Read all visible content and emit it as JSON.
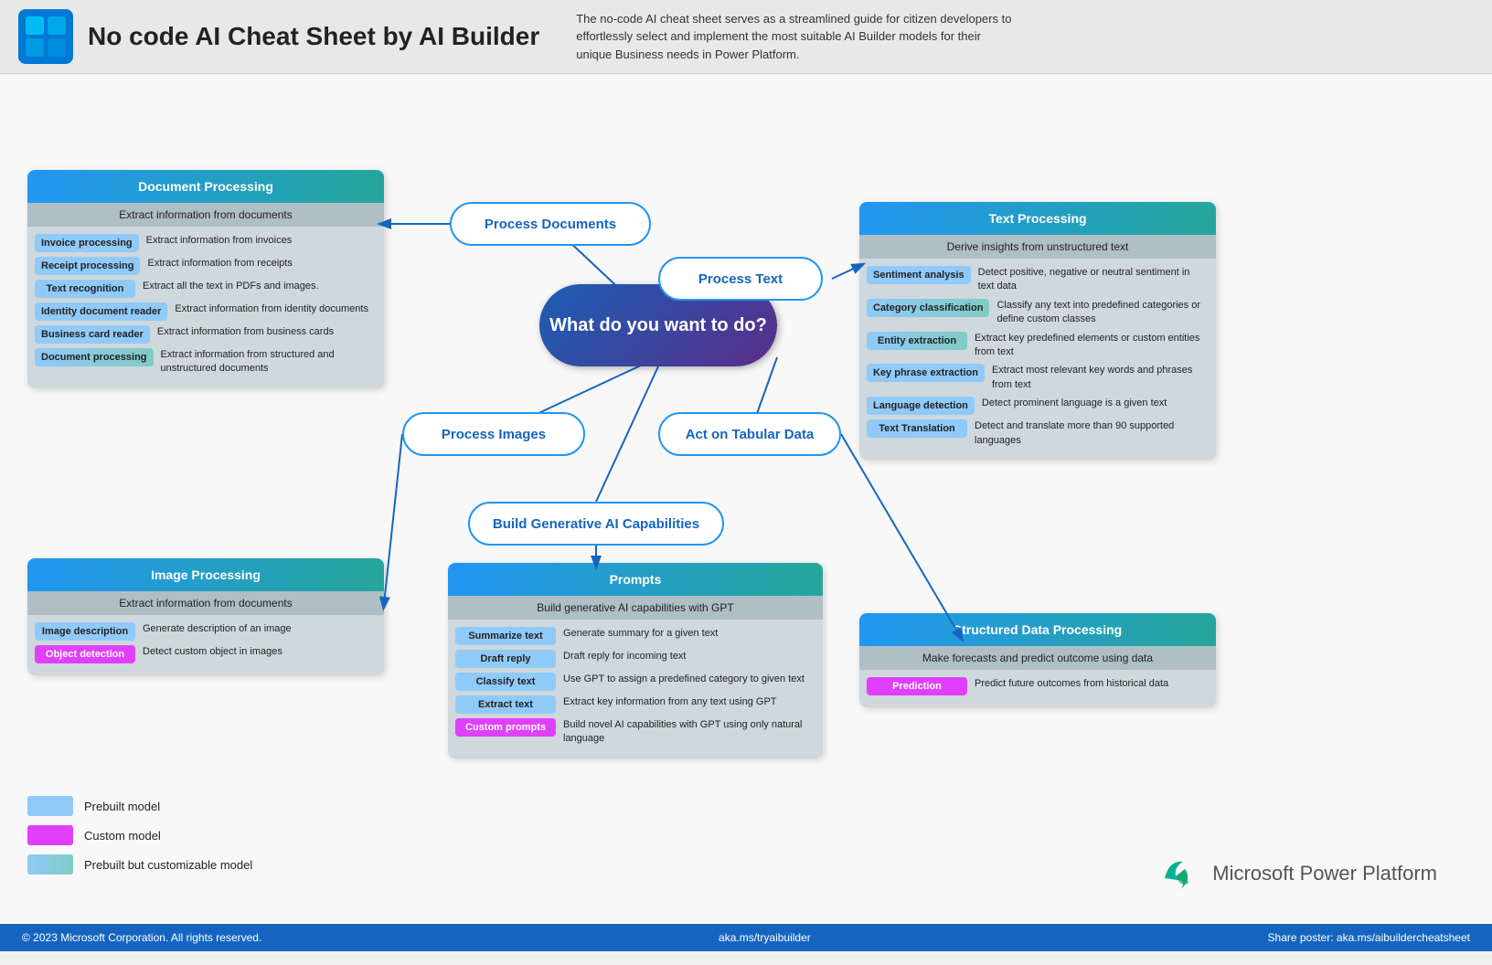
{
  "header": {
    "title": "No code AI Cheat Sheet by AI Builder",
    "description": "The no-code AI cheat sheet serves as a streamlined guide for citizen developers to effortlessly select and implement the most suitable AI Builder models for their unique Business needs in Power Platform."
  },
  "center_bubble": {
    "text": "What do you want to do?"
  },
  "flow_buttons": {
    "process_docs": "Process Documents",
    "process_text": "Process Text",
    "process_images": "Process Images",
    "tabular_data": "Act on Tabular Data",
    "gen_ai": "Build Generative AI Capabilities"
  },
  "document_processing": {
    "header": "Document Processing",
    "subheader": "Extract information from documents",
    "items": [
      {
        "badge": "Invoice processing",
        "badge_type": "blue",
        "desc": "Extract information from invoices"
      },
      {
        "badge": "Receipt processing",
        "badge_type": "blue",
        "desc": "Extract information from receipts"
      },
      {
        "badge": "Text  recognition",
        "badge_type": "blue",
        "desc": "Extract all the text in PDFs and images."
      },
      {
        "badge": "Identity document reader",
        "badge_type": "blue",
        "desc": "Extract information from identity documents"
      },
      {
        "badge": "Business card reader",
        "badge_type": "blue",
        "desc": "Extract information from business cards"
      },
      {
        "badge": "Document processing",
        "badge_type": "cyan",
        "desc": "Extract information from structured and unstructured documents"
      }
    ]
  },
  "text_processing": {
    "header": "Text Processing",
    "subheader": "Derive insights from unstructured text",
    "items": [
      {
        "badge": "Sentiment analysis",
        "badge_type": "blue",
        "desc": "Detect positive, negative or neutral sentiment in text data"
      },
      {
        "badge": "Category classification",
        "badge_type": "cyan",
        "desc": "Classify any text into predefined categories or define custom classes"
      },
      {
        "badge": "Entity extraction",
        "badge_type": "cyan",
        "desc": "Extract key predefined elements or custom entities from text"
      },
      {
        "badge": "Key phrase extraction",
        "badge_type": "blue",
        "desc": "Extract most relevant key words and phrases from text"
      },
      {
        "badge": "Language detection",
        "badge_type": "blue",
        "desc": "Detect prominent language is a given text"
      },
      {
        "badge": "Text Translation",
        "badge_type": "blue",
        "desc": "Detect and translate more than 90 supported languages"
      }
    ]
  },
  "image_processing": {
    "header": "Image Processing",
    "subheader": "Extract information from documents",
    "items": [
      {
        "badge": "Image description",
        "badge_type": "blue",
        "desc": "Generate description of an image"
      },
      {
        "badge": "Object detection",
        "badge_type": "pink",
        "desc": "Detect custom object in images"
      }
    ]
  },
  "structured_data": {
    "header": "Structured Data Processing",
    "subheader": "Make forecasts and predict outcome using data",
    "items": [
      {
        "badge": "Prediction",
        "badge_type": "pink",
        "desc": "Predict future outcomes from historical data"
      }
    ]
  },
  "prompts": {
    "header": "Prompts",
    "subheader": "Build generative AI capabilities with GPT",
    "items": [
      {
        "badge": "Summarize text",
        "badge_type": "blue",
        "desc": "Generate summary for a given text"
      },
      {
        "badge": "Draft reply",
        "badge_type": "blue",
        "desc": "Draft reply for incoming text"
      },
      {
        "badge": "Classify text",
        "badge_type": "blue",
        "desc": "Use GPT to assign a predefined category to given text"
      },
      {
        "badge": "Extract text",
        "badge_type": "blue",
        "desc": "Extract key information from any text using GPT"
      },
      {
        "badge": "Custom prompts",
        "badge_type": "pink",
        "desc": "Build novel AI capabilities with GPT using only natural language"
      }
    ]
  },
  "legend": {
    "items": [
      {
        "label": "Prebuilt model",
        "type": "blue"
      },
      {
        "label": "Custom model",
        "type": "pink"
      },
      {
        "label": "Prebuilt but customizable model",
        "type": "cyan"
      }
    ]
  },
  "footer": {
    "copyright": "© 2023 Microsoft Corporation. All rights reserved.",
    "link1": "aka.ms/tryaibuilder",
    "link2": "Share poster: aka.ms/aibuildercheatsheet"
  },
  "power_platform": {
    "label": "Microsoft Power Platform"
  }
}
